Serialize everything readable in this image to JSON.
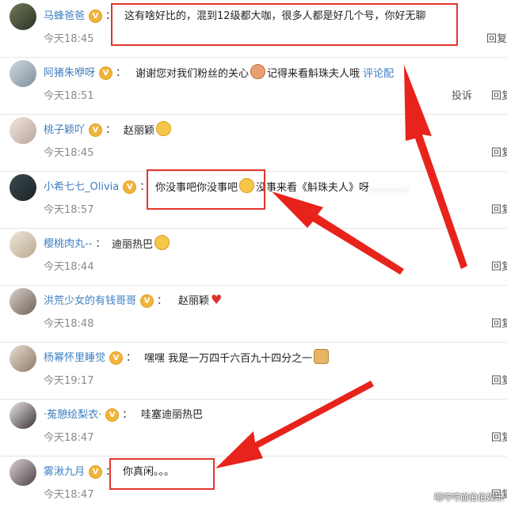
{
  "comments": [
    {
      "name": "马蜂爸爸",
      "content": "这有啥好比的，混到12级都大咖，很多人都是好几个号，你好无聊",
      "time": "今天18:45",
      "reply": "回复"
    },
    {
      "name": "阿猪朱咿呀",
      "content_a": "谢谢您对我们粉丝的关心",
      "content_b": "记得来看斛珠夫人哦",
      "link": "评论配",
      "time": "今天18:51",
      "report": "投诉",
      "reply": "回复"
    },
    {
      "name": "桃子颖吖",
      "content": "赵丽颖",
      "time": "今天18:45",
      "reply": "回复"
    },
    {
      "name": "小希七七_Olivia",
      "content_a": "你没事吧你没事吧",
      "content_b": "没事来看《斛珠夫人》呀",
      "blurred": "。。。。。。。。",
      "time": "今天18:57",
      "reply": "回复"
    },
    {
      "name": "樱桃肉丸--",
      "content": "迪丽热巴",
      "time": "今天18:44",
      "reply": "回复"
    },
    {
      "name": "洪荒少女的有钱哥哥",
      "content": "赵丽颖",
      "time": "今天18:48",
      "reply": "回复"
    },
    {
      "name": "杨幂怀里睡觉",
      "content": "嘿嘿 我是一万四千六百九十四分之一",
      "time": "今天19:17",
      "reply": "回复"
    },
    {
      "name": "·菟憩绘梨衣·",
      "content": "哇塞迪丽热巴",
      "time": "今天18:47",
      "reply": "回复"
    },
    {
      "name": "雾湫九月",
      "content": "你真闲。。。",
      "time": "今天18:47",
      "reply": "回复"
    }
  ],
  "badge_symbol": "V",
  "separator": "：",
  "watermark": "嗯哼哼崩伯伯娱乐",
  "colors": {
    "accent": "#3d7fc2",
    "badge": "#f1b43a",
    "highlight": "#e4352d"
  }
}
